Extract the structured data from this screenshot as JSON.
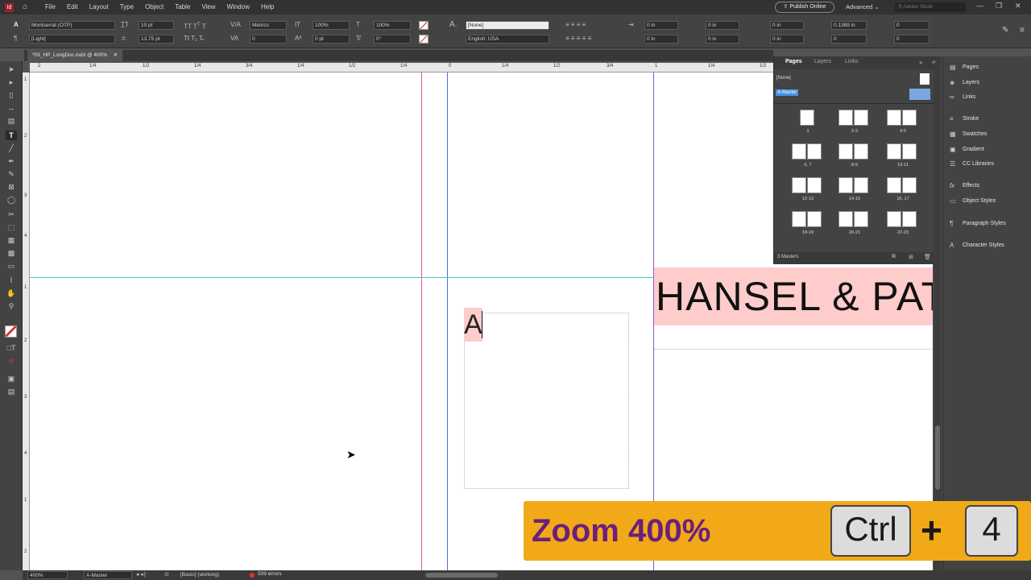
{
  "menu": [
    "File",
    "Edit",
    "Layout",
    "Type",
    "Object",
    "Table",
    "View",
    "Window",
    "Help"
  ],
  "top_right": {
    "publish": "Publish Online",
    "workspace": "Advanced",
    "stock_placeholder": "Adobe Stock"
  },
  "control": {
    "font_family": "Montserrat (OTP)",
    "font_style": "[Light]",
    "font_size": "10 pt",
    "leading": "13.75 pt",
    "kerning": "Metrics",
    "tracking": "0",
    "vscale": "100%",
    "hscale": "100%",
    "baseline": "0 pt",
    "skew": "0°",
    "char_style": "[None]",
    "language": "English: USA",
    "indent1": "0 in",
    "indent2": "0 in",
    "indent3": "0 in",
    "indent4": "0 in",
    "indent5": "0 in",
    "indent6": "0 in",
    "space": "0.1389 in",
    "space2": "0",
    "dropcap": "0",
    "dropcap2": "0",
    "hyph": "Ignore"
  },
  "doc_tab": "*03_HP_LongDoc.indd @ 400%",
  "hruler_ticks": [
    "2",
    "1/4",
    "1/2",
    "1/4",
    "3/4",
    "1/4",
    "1/2",
    "1/4",
    "0",
    "1/4",
    "1/2",
    "3/4",
    "1",
    "1/4",
    "1/2"
  ],
  "vruler_ticks": [
    "1",
    "2",
    "3",
    "4",
    "1",
    "2",
    "3",
    "4",
    "1",
    "2",
    "3",
    "4",
    "1",
    "2",
    "3",
    "4"
  ],
  "canvas": {
    "frame_letter": "A",
    "headline": "HANSEL & PAT"
  },
  "pages_panel": {
    "tabs": [
      "Pages",
      "Layers",
      "Links"
    ],
    "none": "[None]",
    "master": "A-Master",
    "thumb_labels": [
      "1",
      "2-3",
      "4-5",
      "6, 7",
      "8-9",
      "10-11",
      "12-13",
      "14-15",
      "16, 17",
      "18-19",
      "20-21",
      "22-23"
    ],
    "footer": "3 Masters"
  },
  "dock": {
    "items": [
      "Pages",
      "Layers",
      "Links",
      "Stroke",
      "Swatches",
      "Gradient",
      "CC Libraries",
      "Effects",
      "Object Styles",
      "Paragraph Styles",
      "Character Styles"
    ],
    "icons": [
      "pages-icon",
      "layers-icon",
      "links-icon",
      "stroke-icon",
      "swatches-icon",
      "gradient-icon",
      "cc-libraries-icon",
      "effects-icon",
      "object-styles-icon",
      "paragraph-styles-icon",
      "character-styles-icon"
    ]
  },
  "status": {
    "zoom": "400%",
    "page": "A-Master",
    "preflight_profile": "[Basic] (working)",
    "errors": "509 errors"
  },
  "overlay": {
    "text": "Zoom 400%",
    "key1": "Ctrl",
    "plus": "+",
    "key2": "4"
  },
  "colors": {
    "accent": "#f2a917",
    "overlay_text": "#6b1f7e",
    "highlight": "#ffcccc",
    "guide_magenta": "#d95f84",
    "guide_blue": "#4f6fd1",
    "guide_cyan": "#3ec9c9",
    "error_red": "#e03030",
    "selection": "#4a90e2"
  }
}
